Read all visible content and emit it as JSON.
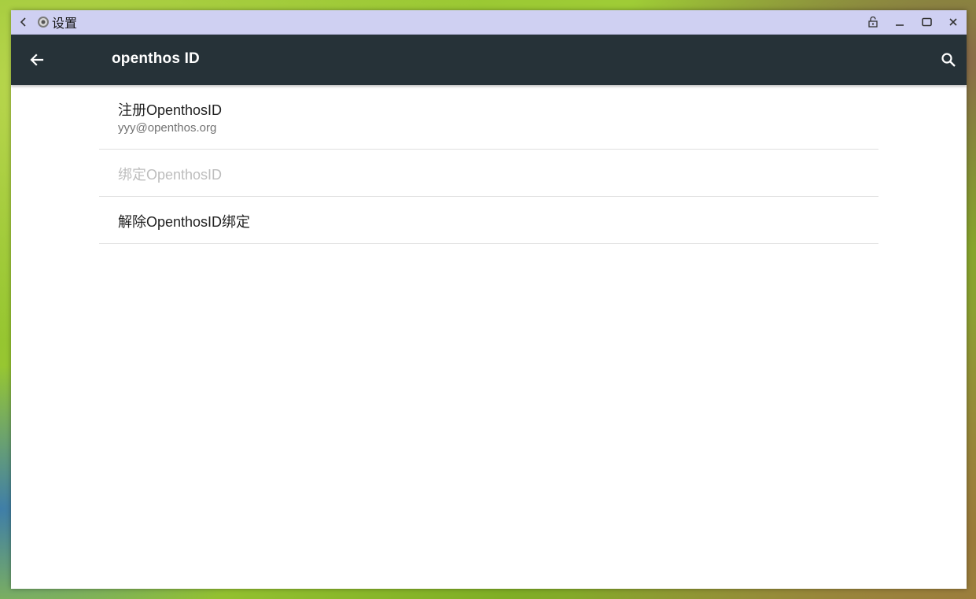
{
  "window": {
    "title": "设置",
    "controls": [
      "pin-icon",
      "minimize-icon",
      "maximize-icon",
      "close-icon"
    ]
  },
  "appbar": {
    "title": "openthos ID",
    "back_icon": "arrow-back-icon",
    "search_icon": "search-icon",
    "color": "#263238"
  },
  "list": {
    "items": [
      {
        "title": "注册OpenthosID",
        "summary": "yyy@openthos.org",
        "enabled": true
      },
      {
        "title": "绑定OpenthosID",
        "summary": "",
        "enabled": false
      },
      {
        "title": "解除OpenthosID绑定",
        "summary": "",
        "enabled": true
      }
    ]
  },
  "colors": {
    "titlebar": "#cfd0f2",
    "text_primary": "#212121",
    "text_secondary": "#727272",
    "text_disabled": "#bdbdbd"
  }
}
